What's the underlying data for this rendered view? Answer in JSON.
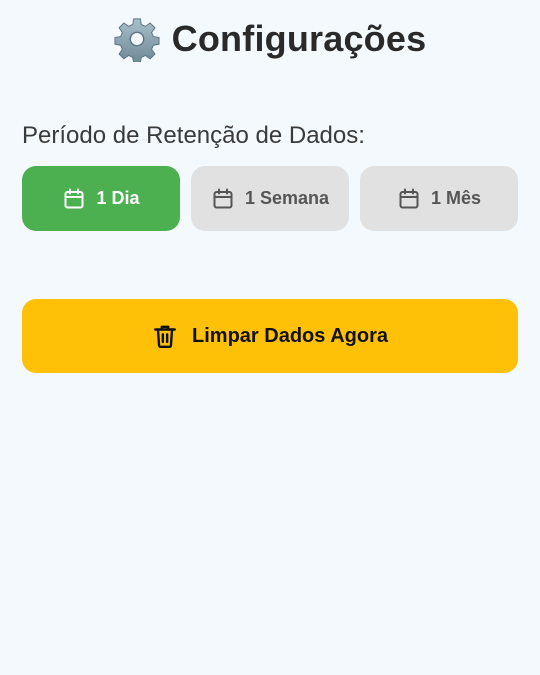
{
  "header": {
    "icon": "gear-icon",
    "title": "Configurações"
  },
  "retention": {
    "label": "Período de Retenção de Dados:",
    "options": [
      {
        "label": "1 Dia",
        "icon": "calendar-icon",
        "selected": true
      },
      {
        "label": "1 Semana",
        "icon": "calendar-icon",
        "selected": false
      },
      {
        "label": "1 Mês",
        "icon": "calendar-icon",
        "selected": false
      }
    ]
  },
  "actions": {
    "clear_label": "Limpar Dados Agora",
    "clear_icon": "trash-icon"
  },
  "colors": {
    "background": "#f3f9fd",
    "selected": "#4caf50",
    "unselected": "#e1e1e1",
    "warning": "#ffc107"
  }
}
